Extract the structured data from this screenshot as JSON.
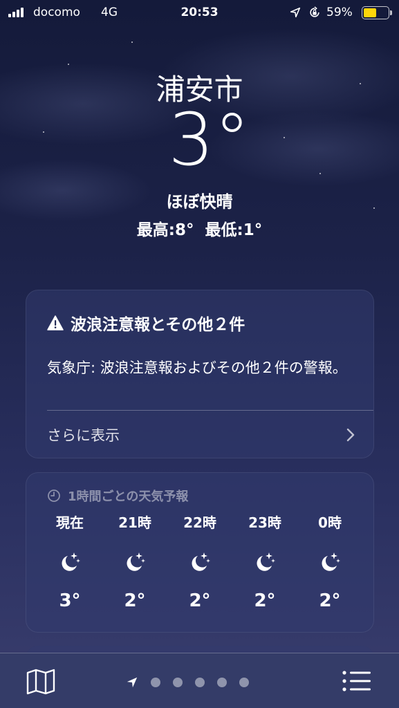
{
  "status_bar": {
    "carrier": "docomo",
    "network": "4G",
    "time": "20:53",
    "battery_percent": "59%",
    "battery_level": 0.59,
    "battery_color": "#ffd60a",
    "icons": [
      "signal-icon",
      "location-arrow-icon",
      "orientation-lock-icon",
      "battery-icon"
    ]
  },
  "weather": {
    "city": "浦安市",
    "temperature": "3°",
    "condition": "ほぼ快晴",
    "high": "最高:8°",
    "low": "最低:1°"
  },
  "alert": {
    "title": "波浪注意報とその他２件",
    "body": "気象庁: 波浪注意報およびその他２件の警報。",
    "more_label": "さらに表示",
    "icons": [
      "warning-icon",
      "chevron-right-icon"
    ]
  },
  "hourly": {
    "header": "1時間ごとの天気予報",
    "items": [
      {
        "time": "現在",
        "icon": "moon-stars-icon",
        "temp": "3°"
      },
      {
        "time": "21時",
        "icon": "moon-stars-icon",
        "temp": "2°"
      },
      {
        "time": "22時",
        "icon": "moon-stars-icon",
        "temp": "2°"
      },
      {
        "time": "23時",
        "icon": "moon-stars-icon",
        "temp": "2°"
      },
      {
        "time": "0時",
        "icon": "moon-stars-icon",
        "temp": "2°"
      }
    ]
  },
  "bottom_bar": {
    "page_count": 6,
    "current_page": 0,
    "icons": [
      "map-icon",
      "location-arrow-icon",
      "list-icon"
    ]
  }
}
